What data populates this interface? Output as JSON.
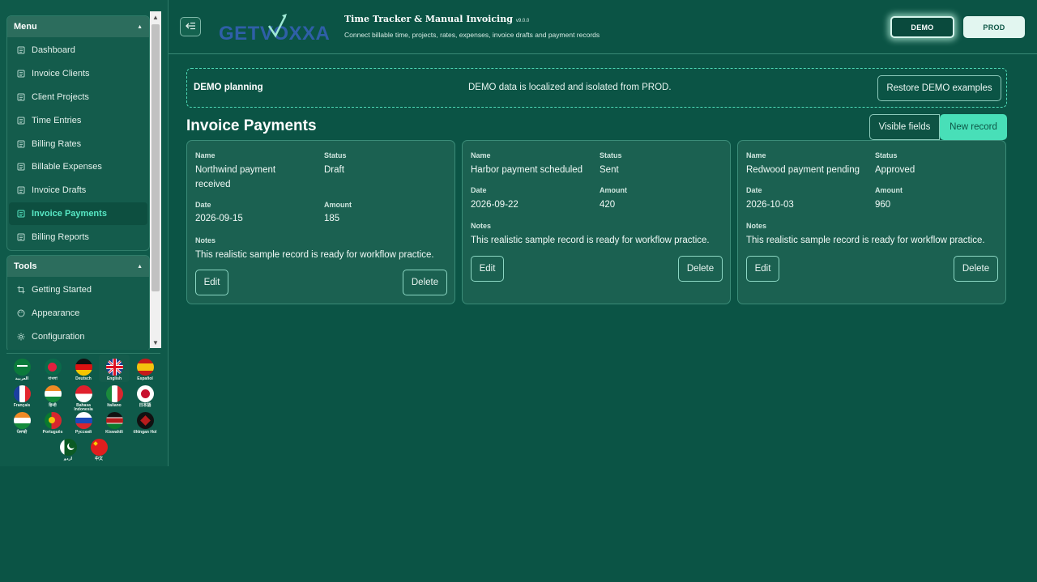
{
  "sidebar": {
    "menu": {
      "title": "Menu",
      "items": [
        {
          "label": "Dashboard",
          "active": false
        },
        {
          "label": "Invoice Clients",
          "active": false
        },
        {
          "label": "Client Projects",
          "active": false
        },
        {
          "label": "Time Entries",
          "active": false
        },
        {
          "label": "Billing Rates",
          "active": false
        },
        {
          "label": "Billable Expenses",
          "active": false
        },
        {
          "label": "Invoice Drafts",
          "active": false
        },
        {
          "label": "Invoice Payments",
          "active": true
        },
        {
          "label": "Billing Reports",
          "active": false
        }
      ]
    },
    "tools": {
      "title": "Tools",
      "items": [
        {
          "label": "Getting Started",
          "icon": "crop-icon"
        },
        {
          "label": "Appearance",
          "icon": "palette-icon"
        },
        {
          "label": "Configuration",
          "icon": "gear-icon"
        }
      ]
    },
    "languages": [
      {
        "label": "العربية",
        "selected": false
      },
      {
        "label": "বাংলা",
        "selected": false
      },
      {
        "label": "Deutsch",
        "selected": false
      },
      {
        "label": "English",
        "selected": true
      },
      {
        "label": "Español",
        "selected": false
      },
      {
        "label": "Français",
        "selected": false
      },
      {
        "label": "हिन्दी",
        "selected": false
      },
      {
        "label": "Bahasa Indonesia",
        "selected": false
      },
      {
        "label": "Italiano",
        "selected": false
      },
      {
        "label": "日本語",
        "selected": false
      },
      {
        "label": "ਪੰਜਾਬੀ",
        "selected": false
      },
      {
        "label": "Português",
        "selected": false
      },
      {
        "label": "Русский",
        "selected": false
      },
      {
        "label": "Kiswahili",
        "selected": false
      },
      {
        "label": "tlhIngan Hol",
        "selected": false
      },
      {
        "label": "اردو",
        "selected": false
      },
      {
        "label": "中文",
        "selected": false
      }
    ]
  },
  "header": {
    "logo_text": "GETVOXXA",
    "title": "Time Tracker & Manual Invoicing",
    "version": "v9.0.0",
    "subtitle": "Connect billable time, projects, rates, expenses, invoice drafts and payment records",
    "env_demo": "DEMO",
    "env_prod": "PROD"
  },
  "banner": {
    "title": "DEMO planning",
    "message": "DEMO data is localized and isolated from PROD.",
    "restore_label": "Restore DEMO examples"
  },
  "page": {
    "title": "Invoice Payments",
    "visible_fields_label": "Visible fields",
    "new_record_label": "New record"
  },
  "field_labels": {
    "name": "Name",
    "status": "Status",
    "date": "Date",
    "amount": "Amount",
    "notes": "Notes",
    "edit": "Edit",
    "delete": "Delete"
  },
  "records": [
    {
      "name_line1": "Northwind payment",
      "name_line2": "received",
      "status": "Draft",
      "date": "2026-09-15",
      "amount": "185",
      "notes": "This realistic sample record is ready for workflow practice."
    },
    {
      "name_line1": "Harbor payment scheduled",
      "name_line2": "",
      "status": "Sent",
      "date": "2026-09-22",
      "amount": "420",
      "notes": "This realistic sample record is ready for workflow practice."
    },
    {
      "name_line1": "Redwood payment pending",
      "name_line2": "",
      "status": "Approved",
      "date": "2026-10-03",
      "amount": "960",
      "notes": "This realistic sample record is ready for workflow practice."
    }
  ]
}
